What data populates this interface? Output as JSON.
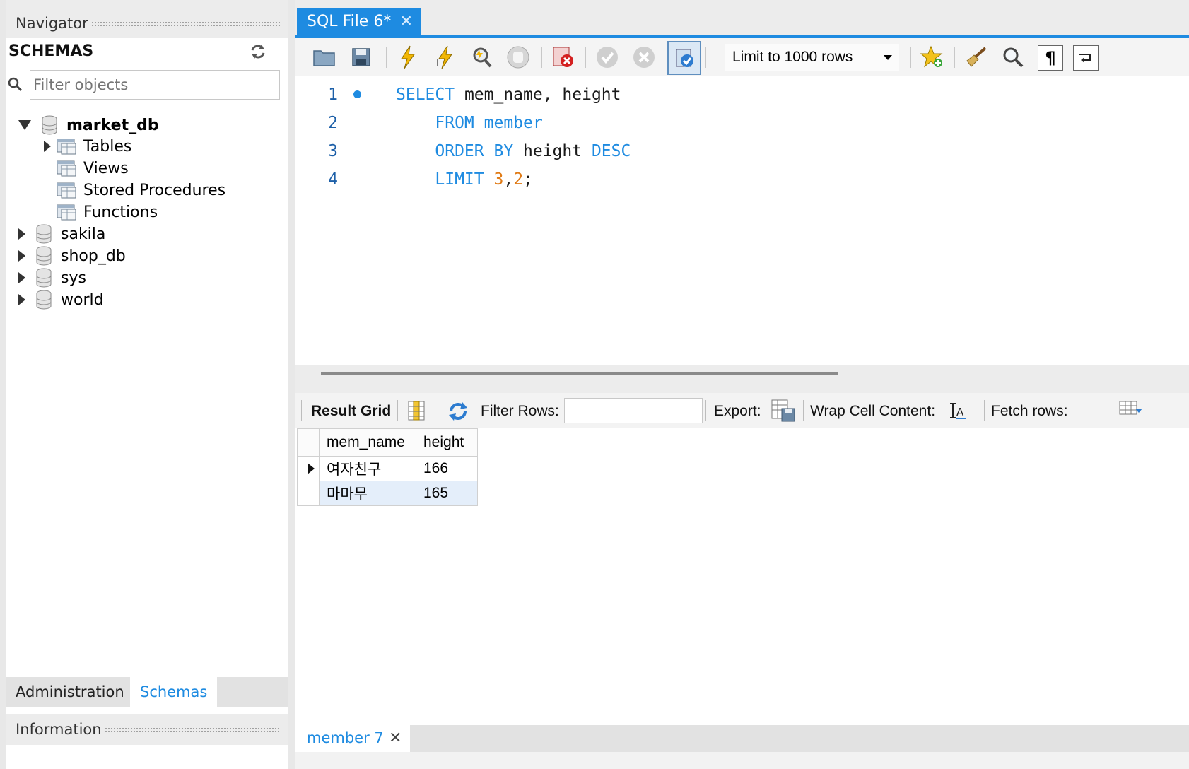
{
  "navigator": {
    "title": "Navigator",
    "schemas_label": "SCHEMAS",
    "filter_placeholder": "Filter objects",
    "tree": [
      {
        "label": "market_db",
        "expanded": true,
        "children": [
          "Tables",
          "Views",
          "Stored Procedures",
          "Functions"
        ]
      },
      {
        "label": "sakila"
      },
      {
        "label": "shop_db"
      },
      {
        "label": "sys"
      },
      {
        "label": "world"
      }
    ],
    "bottom_tabs": [
      "Administration",
      "Schemas"
    ],
    "active_bottom_tab": "Schemas",
    "information_title": "Information"
  },
  "editor_tab": {
    "label": "SQL File 6*",
    "close": "✕"
  },
  "toolbar": {
    "limit_select": "Limit to 1000 rows",
    "icons": [
      "open-folder-icon",
      "save-icon",
      "execute-icon",
      "execute-current-icon",
      "explain-icon",
      "stop-icon",
      "toggle-error-icon",
      "commit-icon",
      "rollback-icon",
      "autocommit-icon",
      "bookmark-icon",
      "beautify-icon",
      "find-icon",
      "invisible-chars-icon",
      "wrap-icon"
    ]
  },
  "editor": {
    "lines": [
      {
        "n": "1",
        "tokens": [
          [
            "kw",
            "SELECT"
          ],
          [
            "id",
            " mem_name, height"
          ]
        ]
      },
      {
        "n": "2",
        "tokens": [
          [
            "id",
            "    "
          ],
          [
            "kw",
            "FROM member"
          ]
        ]
      },
      {
        "n": "3",
        "tokens": [
          [
            "id",
            "    "
          ],
          [
            "kw",
            "ORDER BY"
          ],
          [
            "id",
            " height "
          ],
          [
            "kw",
            "DESC"
          ]
        ]
      },
      {
        "n": "4",
        "tokens": [
          [
            "id",
            "    "
          ],
          [
            "kw",
            "LIMIT "
          ],
          [
            "num",
            "3"
          ],
          [
            "punc",
            ","
          ],
          [
            "num",
            "2"
          ],
          [
            "punc",
            ";"
          ]
        ]
      }
    ]
  },
  "result_bar": {
    "result_grid": "Result Grid",
    "filter_rows": "Filter Rows:",
    "export": "Export:",
    "wrap_cell": "Wrap Cell Content:",
    "fetch_rows": "Fetch rows:"
  },
  "result_grid": {
    "columns": [
      "mem_name",
      "height"
    ],
    "rows": [
      [
        "여자친구",
        "166"
      ],
      [
        "마마무",
        "165"
      ]
    ]
  },
  "output_tab": {
    "label": "member 7",
    "close": "✕"
  },
  "colors": {
    "accent": "#1e8be1",
    "keyword": "#1e8be1",
    "number": "#e07b16"
  }
}
